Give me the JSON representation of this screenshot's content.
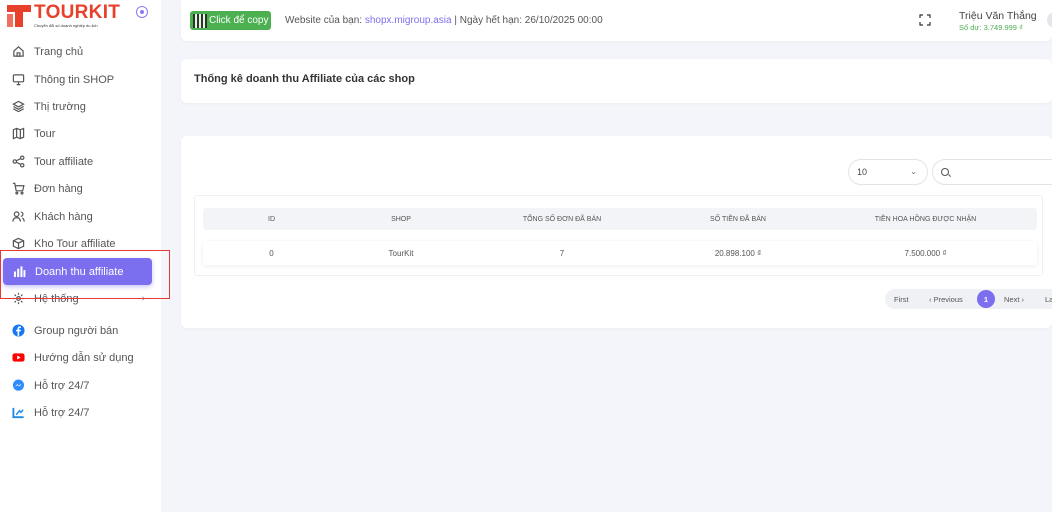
{
  "brand": {
    "name": "TOURKIT",
    "tagline": "Chuyển đổi số doanh nghiệp du lịch",
    "color": "#e8412b"
  },
  "sidebar": {
    "items": [
      {
        "label": "Trang chủ",
        "icon": "home-icon"
      },
      {
        "label": "Thông tin SHOP",
        "icon": "monitor-icon"
      },
      {
        "label": "Thị trường",
        "icon": "layers-icon"
      },
      {
        "label": "Tour",
        "icon": "map-icon"
      },
      {
        "label": "Tour affiliate",
        "icon": "share-icon"
      },
      {
        "label": "Đơn hàng",
        "icon": "cart-icon"
      },
      {
        "label": "Khách hàng",
        "icon": "users-icon"
      },
      {
        "label": "Kho Tour affiliate",
        "icon": "package-icon"
      },
      {
        "label": "Doanh thu affiliate",
        "icon": "bar-chart-icon",
        "active": true
      },
      {
        "label": "Hệ thống",
        "icon": "gear-icon",
        "chevron": "›"
      },
      {
        "label": "Group người bán",
        "icon": "facebook-icon"
      },
      {
        "label": "Hướng dẫn sử dụng",
        "icon": "youtube-icon"
      },
      {
        "label": "Hỗ trợ 24/7",
        "icon": "messenger-icon"
      },
      {
        "label": "Hỗ trợ 24/7",
        "icon": "zalo-icon"
      }
    ]
  },
  "topbar": {
    "copy_label": "Click để copy",
    "site_prefix": "Website của bạn: ",
    "site_url": "shopx.migroup.asia",
    "expiry": " | Ngày hết hạn: 26/10/2025 00:00",
    "user_name": "Triệu Văn Thắng",
    "balance": "Số dư: 3.749.999 ₫"
  },
  "header": {
    "title": "Thống kê doanh thu Affiliate của các shop"
  },
  "table": {
    "page_size": "10",
    "columns": [
      "ID",
      "SHOP",
      "TỔNG SỐ ĐƠN ĐÃ BÁN",
      "SỐ TIỀN ĐÃ BÁN",
      "TIỀN HOA HỒNG ĐƯỢC NHẬN"
    ],
    "rows": [
      [
        "0",
        "TourKit",
        "7",
        "20.898.100 ₫",
        "7.500.000 ₫"
      ]
    ]
  },
  "pagination": {
    "first": "First",
    "prev": "‹ Previous",
    "current": "1",
    "next": "Next ›",
    "last": "La"
  },
  "colors": {
    "accent": "#7b6ff0",
    "success": "#4caf50",
    "highlight_border": "#e53935"
  }
}
